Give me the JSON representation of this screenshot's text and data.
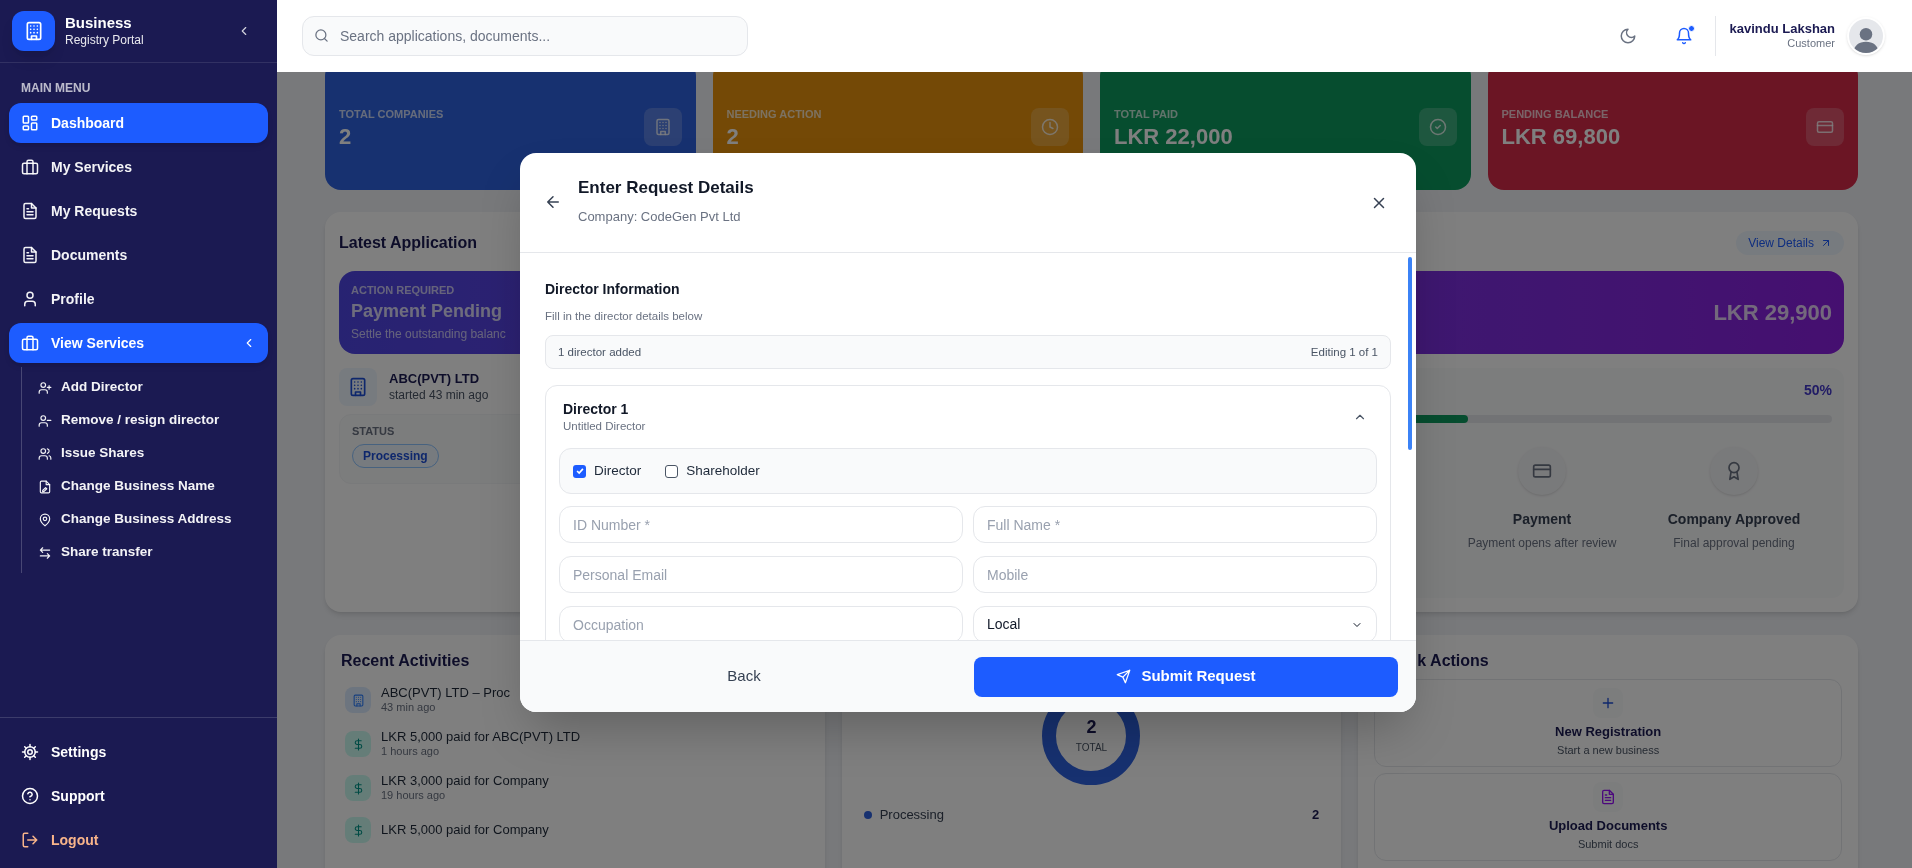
{
  "sidebar": {
    "brand_title": "Business",
    "brand_subtitle": "Registry Portal",
    "section_label": "MAIN MENU",
    "items": [
      {
        "label": "Dashboard",
        "selected": true
      },
      {
        "label": "My Services",
        "selected": false
      },
      {
        "label": "My Requests",
        "selected": false
      },
      {
        "label": "Documents",
        "selected": false
      },
      {
        "label": "Profile",
        "selected": false
      },
      {
        "label": "View Services",
        "selected": true,
        "expanded": true,
        "children": [
          {
            "label": "Add Director"
          },
          {
            "label": "Remove / resign director"
          },
          {
            "label": "Issue Shares"
          },
          {
            "label": "Change Business Name"
          },
          {
            "label": "Change Business Address"
          },
          {
            "label": "Share transfer"
          }
        ]
      }
    ],
    "footer_items": [
      {
        "label": "Settings",
        "kind": "normal"
      },
      {
        "label": "Support",
        "kind": "normal"
      },
      {
        "label": "Logout",
        "kind": "danger"
      }
    ]
  },
  "header": {
    "search_placeholder": "Search applications, documents...",
    "notifications_unread": true,
    "user": {
      "name": "kavindu Lakshan",
      "role": "Customer"
    }
  },
  "stats": [
    {
      "label": "TOTAL COMPANIES",
      "value": "2"
    },
    {
      "label": "NEEDING ACTION",
      "value": "2"
    },
    {
      "label": "TOTAL PAID",
      "value": "LKR 22,000"
    },
    {
      "label": "PENDING BALANCE",
      "value": "LKR 69,800"
    }
  ],
  "latest_application": {
    "title": "Latest Application",
    "view_details": "View Details",
    "banner": {
      "eyebrow": "ACTION REQUIRED",
      "title": "Payment Pending",
      "note": "Settle the outstanding balanc",
      "amount": "LKR 29,900"
    },
    "company": {
      "name": "ABC(PVT) LTD",
      "started": "started 43 min ago"
    },
    "status_label": "STATUS",
    "status": "Processing",
    "progress": {
      "percent": "50%",
      "level": 0.5
    },
    "steps": [
      {
        "title": "Payment",
        "note": "Payment opens after review"
      },
      {
        "title": "Company Approved",
        "note": "Final approval pending"
      }
    ]
  },
  "recent_activities": {
    "title": "Recent Activities",
    "items": [
      {
        "kind": "company",
        "text": "ABC(PVT) LTD – Proc",
        "time": "43 min ago"
      },
      {
        "kind": "payment",
        "text": "LKR 5,000 paid for ABC(PVT) LTD",
        "time": "1 hours ago"
      },
      {
        "kind": "payment",
        "text": "LKR 3,000 paid for Company",
        "time": "19 hours ago"
      },
      {
        "kind": "payment",
        "text": "LKR 5,000 paid for Company"
      }
    ]
  },
  "status_overview": {
    "total": "2",
    "total_label": "TOTAL",
    "legend": [
      {
        "label": "Processing",
        "count": "2"
      }
    ]
  },
  "quick_actions": {
    "title": "k Actions",
    "items": [
      {
        "kind": "add",
        "title": "New Registration",
        "note": "Start a new business"
      },
      {
        "kind": "upload",
        "title": "Upload Documents",
        "note": "Submit docs"
      }
    ]
  },
  "modal": {
    "title": "Enter Request Details",
    "subtitle": "Company: CodeGen Pvt Ltd",
    "section_title": "Director Information",
    "section_note": "Fill in the director details below",
    "summary_left": "1 director added",
    "summary_right": "Editing 1 of 1",
    "directors": [
      {
        "title": "Director 1",
        "subtitle": "Untitled Director",
        "expanded": true,
        "roles": [
          {
            "label": "Director",
            "checked": true
          },
          {
            "label": "Shareholder",
            "checked": false
          }
        ],
        "fields": [
          {
            "kind": "input",
            "placeholder": "ID Number *"
          },
          {
            "kind": "input",
            "placeholder": "Full Name *"
          },
          {
            "kind": "input",
            "placeholder": "Personal Email"
          },
          {
            "kind": "input",
            "placeholder": "Mobile"
          },
          {
            "kind": "input",
            "placeholder": "Occupation"
          },
          {
            "kind": "select",
            "value": "Local"
          }
        ]
      }
    ],
    "back": "Back",
    "submit": "Submit Request"
  }
}
